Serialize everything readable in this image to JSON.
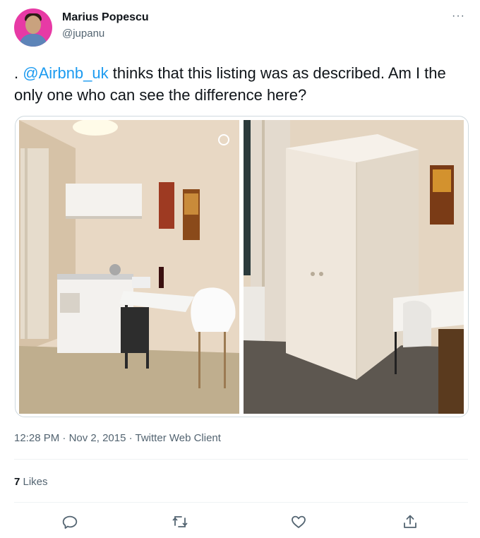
{
  "author": {
    "name": "Marius Popescu",
    "handle": "@jupanu",
    "avatar_color": "#e73aa5"
  },
  "more_menu": "···",
  "tweet": {
    "prefix": ". ",
    "mention": "@Airbnb_uk",
    "text": " thinks that this listing was as described. Am I the only one who can see the difference here?",
    "mention_color": "#1d9bf0"
  },
  "media": {
    "images": [
      {
        "description_icon": "photo-icon"
      },
      {
        "description_icon": "photo-icon"
      }
    ]
  },
  "meta": {
    "time": "12:28 PM",
    "date": "Nov 2, 2015",
    "client": "Twitter Web Client",
    "separator": " · "
  },
  "stats": {
    "likes_count": "7",
    "likes_label": " Likes"
  },
  "actions": [
    {
      "icon": "reply-icon"
    },
    {
      "icon": "retweet-icon"
    },
    {
      "icon": "like-icon"
    },
    {
      "icon": "share-icon"
    }
  ]
}
